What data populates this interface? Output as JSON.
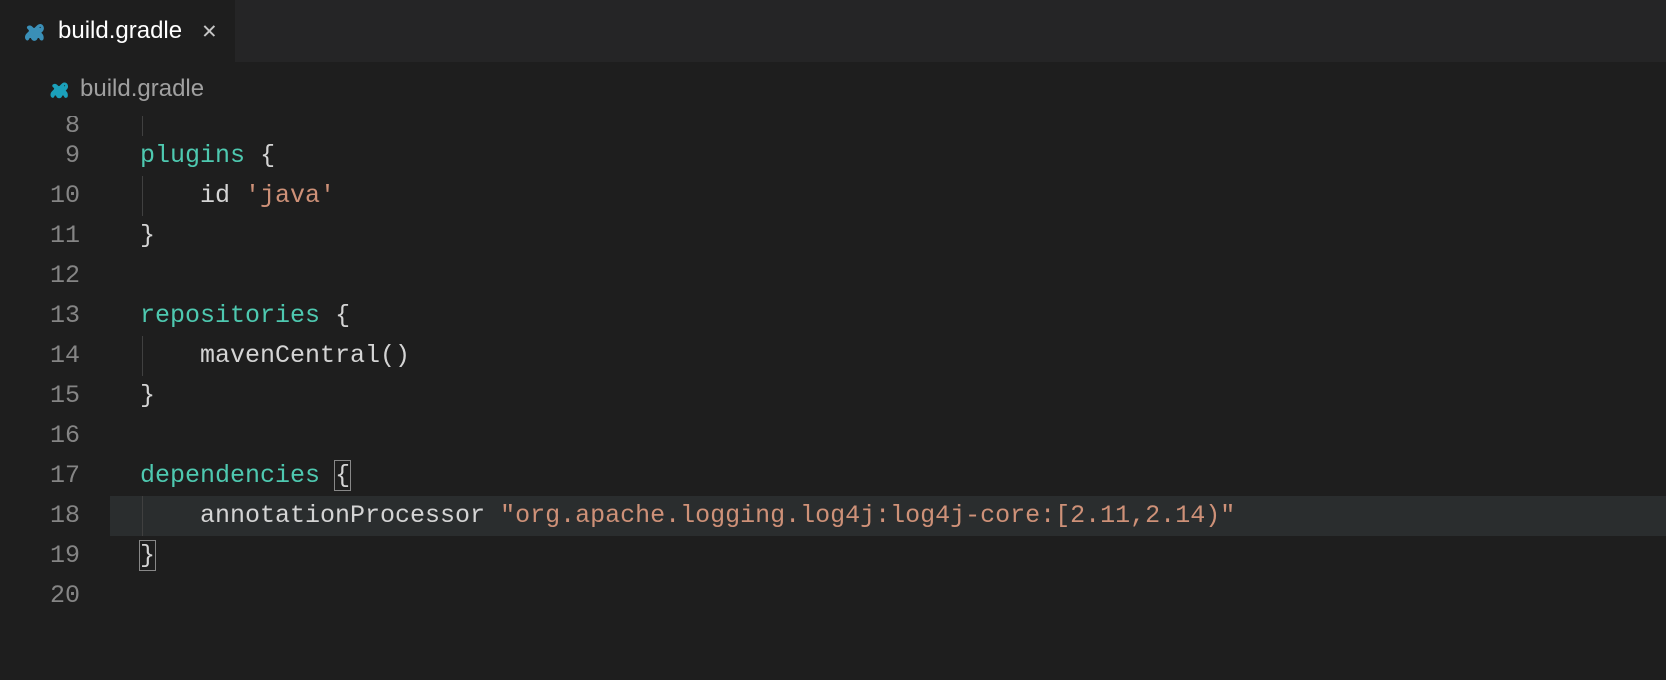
{
  "tab": {
    "label": "build.gradle"
  },
  "breadcrumb": {
    "label": "build.gradle"
  },
  "code": {
    "lines": [
      {
        "num": "8",
        "partial": true,
        "indent": true,
        "tokens": []
      },
      {
        "num": "9",
        "indent": false,
        "tokens": [
          {
            "text": "  ",
            "class": ""
          },
          {
            "text": "plugins",
            "class": "tok-keyword"
          },
          {
            "text": " ",
            "class": ""
          },
          {
            "text": "{",
            "class": "tok-brace"
          }
        ]
      },
      {
        "num": "10",
        "indent": true,
        "tokens": [
          {
            "text": "      ",
            "class": ""
          },
          {
            "text": "id",
            "class": "tok-ident"
          },
          {
            "text": " ",
            "class": ""
          },
          {
            "text": "'java'",
            "class": "tok-string"
          }
        ]
      },
      {
        "num": "11",
        "indent": false,
        "tokens": [
          {
            "text": "  ",
            "class": ""
          },
          {
            "text": "}",
            "class": "tok-brace"
          }
        ]
      },
      {
        "num": "12",
        "indent": false,
        "tokens": []
      },
      {
        "num": "13",
        "indent": false,
        "tokens": [
          {
            "text": "  ",
            "class": ""
          },
          {
            "text": "repositories",
            "class": "tok-keyword"
          },
          {
            "text": " ",
            "class": ""
          },
          {
            "text": "{",
            "class": "tok-brace"
          }
        ]
      },
      {
        "num": "14",
        "indent": true,
        "tokens": [
          {
            "text": "      ",
            "class": ""
          },
          {
            "text": "mavenCentral",
            "class": "tok-ident"
          },
          {
            "text": "()",
            "class": "tok-paren"
          }
        ]
      },
      {
        "num": "15",
        "indent": false,
        "tokens": [
          {
            "text": "  ",
            "class": ""
          },
          {
            "text": "}",
            "class": "tok-brace"
          }
        ]
      },
      {
        "num": "16",
        "indent": false,
        "tokens": []
      },
      {
        "num": "17",
        "indent": false,
        "tokens": [
          {
            "text": "  ",
            "class": ""
          },
          {
            "text": "dependencies",
            "class": "tok-keyword"
          },
          {
            "text": " ",
            "class": ""
          },
          {
            "text": "{",
            "class": "tok-brace bracket-highlight"
          }
        ]
      },
      {
        "num": "18",
        "indent": true,
        "highlighted": true,
        "tokens": [
          {
            "text": "      ",
            "class": ""
          },
          {
            "text": "annotationProcessor",
            "class": "tok-ident"
          },
          {
            "text": " ",
            "class": ""
          },
          {
            "text": "\"org.apache.logging.log4j:log4j-core:[2.11,2.14)\"",
            "class": "tok-string"
          }
        ]
      },
      {
        "num": "19",
        "indent": false,
        "tokens": [
          {
            "text": "  ",
            "class": ""
          },
          {
            "text": "}",
            "class": "tok-brace bracket-highlight"
          }
        ]
      },
      {
        "num": "20",
        "indent": false,
        "tokens": []
      }
    ]
  }
}
